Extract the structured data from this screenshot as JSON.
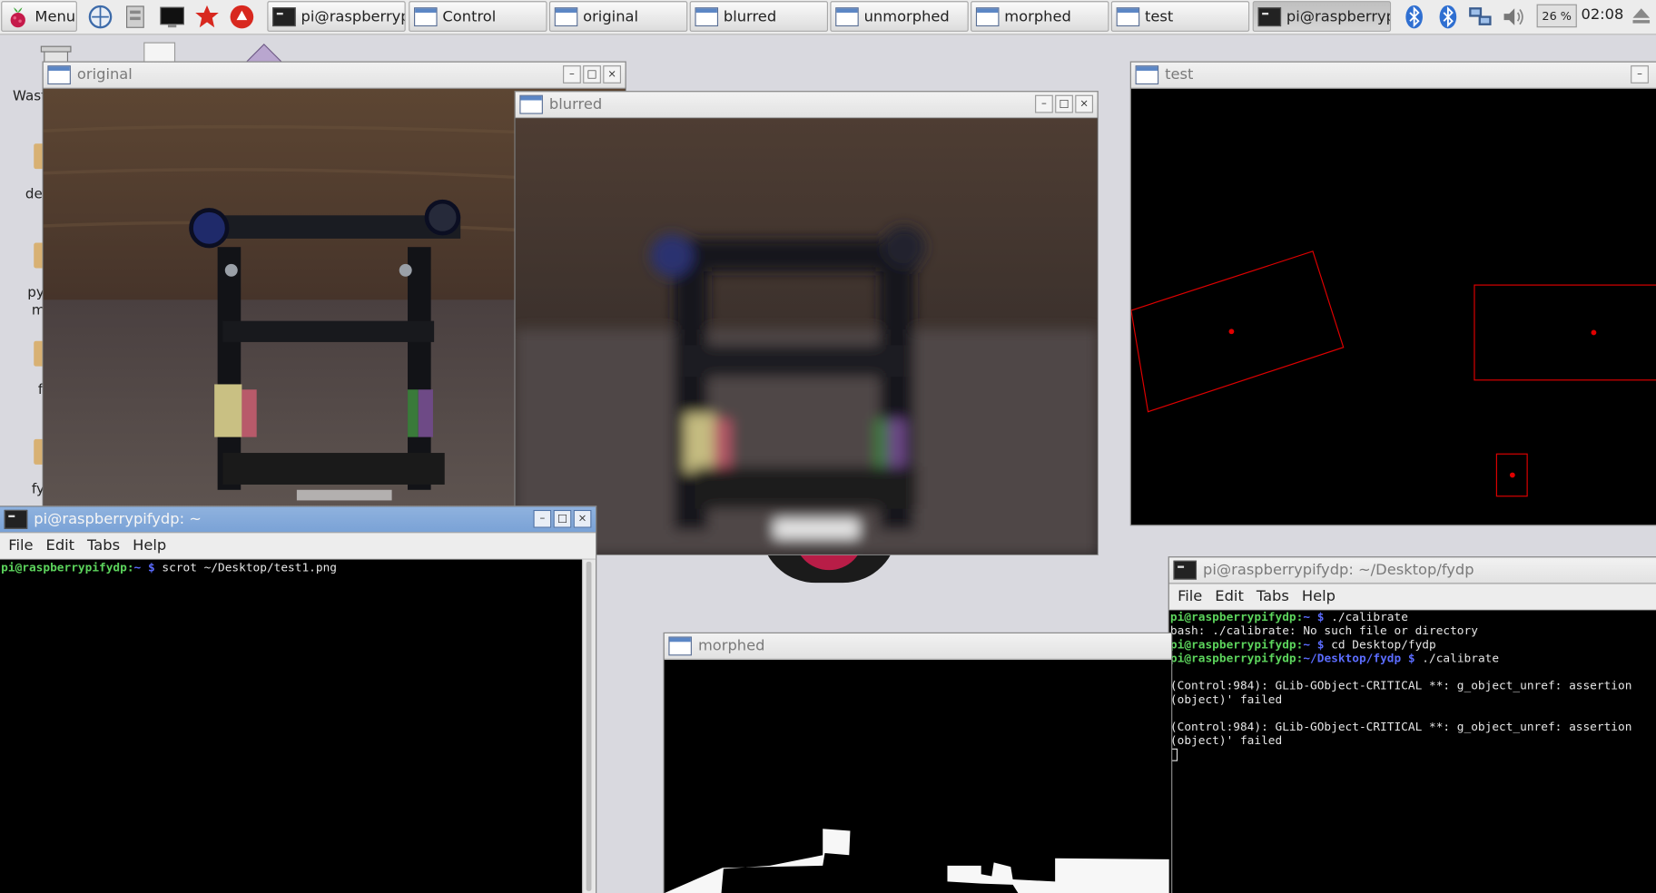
{
  "taskbar": {
    "menu_label": "Menu",
    "tasks": [
      {
        "label": "pi@raspberrypi...",
        "kind": "terminal"
      },
      {
        "label": "Control",
        "kind": "window"
      },
      {
        "label": "original",
        "kind": "window"
      },
      {
        "label": "blurred",
        "kind": "window"
      },
      {
        "label": "unmorphed",
        "kind": "window"
      },
      {
        "label": "morphed",
        "kind": "window"
      },
      {
        "label": "test",
        "kind": "window"
      },
      {
        "label": "pi@raspberrypi...",
        "kind": "terminal",
        "active": true
      }
    ],
    "cpu_label": "26 %",
    "clock": "02:08"
  },
  "desktop": {
    "icons": [
      "Wast",
      "det",
      "py",
      "m",
      "f",
      "fy"
    ]
  },
  "windows": {
    "original": {
      "title": "original"
    },
    "blurred": {
      "title": "blurred"
    },
    "test": {
      "title": "test"
    },
    "morphed": {
      "title": "morphed"
    },
    "terminal_home": {
      "title": "pi@raspberrypifydp: ~",
      "menu": [
        "File",
        "Edit",
        "Tabs",
        "Help"
      ],
      "lines": [
        {
          "user": "pi@raspberrypifydp",
          "path": "~",
          "cmd": "scrot ~/Desktop/test1.png"
        }
      ]
    },
    "terminal_fydp": {
      "title": "pi@raspberrypifydp: ~/Desktop/fydp",
      "menu": [
        "File",
        "Edit",
        "Tabs",
        "Help"
      ],
      "line1_user": "pi@raspberrypifydp",
      "line1_path": "~",
      "line1_cmd": "./calibrate",
      "line2": "bash: ./calibrate: No such file or directory",
      "line3_user": "pi@raspberrypifydp",
      "line3_path": "~",
      "line3_cmd": "cd Desktop/fydp",
      "line4_user": "pi@raspberrypifydp",
      "line4_path": "~/Desktop/fydp",
      "line4_cmd": "./calibrate",
      "err1a": "(Control:984): GLib-GObject-CRITICAL **: g_object_unref: assertion",
      "err1b": "(object)' failed",
      "err2a": "(Control:984): GLib-GObject-CRITICAL **: g_object_unref: assertion",
      "err2b": "(object)' failed"
    }
  },
  "colors": {
    "prompt_user": "#5cd45c",
    "prompt_path": "#5b6cff",
    "contour": "#e00000",
    "titlebar_active": "#7aa2d6"
  }
}
